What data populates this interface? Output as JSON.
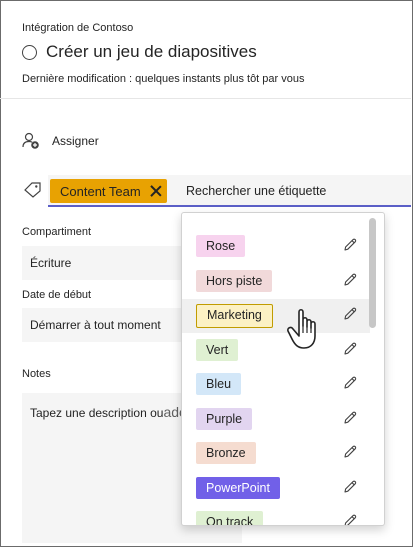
{
  "header": {
    "plan_name": "Intégration de Contoso",
    "task_title": "Créer un jeu de diapositives",
    "last_modified": "Dernière modification : quelques instants plus tôt par vous"
  },
  "assign": {
    "label": "Assigner"
  },
  "labels": {
    "selected_chip": "Content Team",
    "search_placeholder": "Rechercher une étiquette",
    "options": [
      {
        "name": "Rose",
        "color": "#f7d3ee",
        "text_color": "#242424",
        "border": ""
      },
      {
        "name": "Hors piste",
        "color": "#f1d9da",
        "text_color": "#242424",
        "border": ""
      },
      {
        "name": "Marketing",
        "color": "#fcf1c4",
        "text_color": "#242424",
        "border": "#c19c00"
      },
      {
        "name": "Vert",
        "color": "#dff0d2",
        "text_color": "#242424",
        "border": ""
      },
      {
        "name": "Bleu",
        "color": "#d3e7f8",
        "text_color": "#242424",
        "border": ""
      },
      {
        "name": "Purple",
        "color": "#e2d5f0",
        "text_color": "#242424",
        "border": ""
      },
      {
        "name": "Bronze",
        "color": "#f5dcd0",
        "text_color": "#242424",
        "border": ""
      },
      {
        "name": "PowerPoint",
        "color": "#7160e8",
        "text_color": "#ffffff",
        "border": ""
      },
      {
        "name": "On track",
        "color": "#dff0d2",
        "text_color": "#242424",
        "border": ""
      }
    ],
    "chip_color": "#e8a202"
  },
  "bucket": {
    "label": "Compartiment",
    "value": "Écriture"
  },
  "start_date": {
    "label": "Date de début",
    "value": "Démarrer à tout moment"
  },
  "notes": {
    "label": "Notes",
    "placeholder": "Tapez une description ou",
    "overlap_text": "ade"
  },
  "accent": "#5b5fc7"
}
